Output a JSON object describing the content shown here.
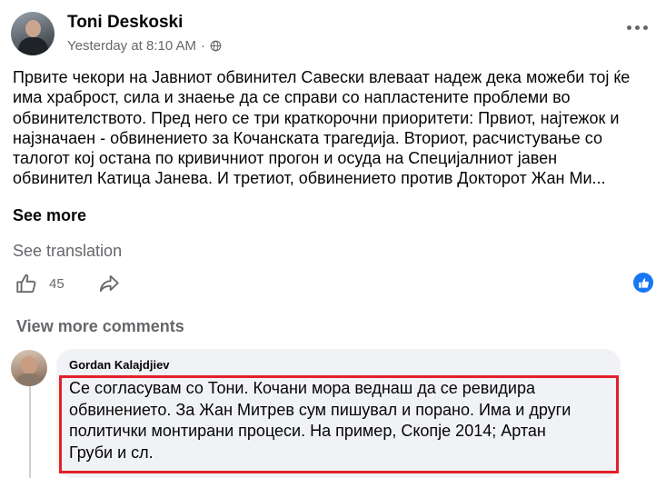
{
  "post": {
    "author": "Toni Deskoski",
    "time": "Yesterday at 8:10 AM",
    "separator": "·",
    "text_lines": [
      "Првите чекори на Јавниот обвинител Савески влеваат надеж дека можеби тој ќе",
      "има храброст, сила и знаење да се справи со напластените проблеми во",
      "обвинителството. Пред него се три краткорочни приоритети: Првиот, најтежок и",
      "најзначаен - обвинението за Кочанската трагедија. Вториот, расчистување со",
      "талогот кој остана по кривичниот прогон и осуда на Специјалниот јавен",
      "обвинител Катица Јанева. И третиот, обвинението против Докторот Жан Ми..."
    ],
    "see_more": "See more",
    "see_translation": "See translation",
    "like_count": "45"
  },
  "comments": {
    "view_more": "View more comments",
    "items": [
      {
        "author": "Gordan Kalajdjiev",
        "text_lines": [
          "Се согласувам со Тони. Кочани мора веднаш да се ревидира",
          "обвинението. За Жан Митрев сум пишувал и порано. Има и други",
          "политички монтирани процеси. На пример, Скопје 2014; Артан",
          "Груби и сл."
        ]
      }
    ]
  },
  "icons": {
    "globe": "globe-icon",
    "more": "more-options-icon",
    "like": "like-icon",
    "share": "share-icon",
    "like_reaction": "like-reaction-icon"
  },
  "colors": {
    "text": "#050505",
    "secondary": "#65676b",
    "accent": "#1877f2",
    "highlight": "#e3202b",
    "bubble": "#f0f2f5"
  }
}
